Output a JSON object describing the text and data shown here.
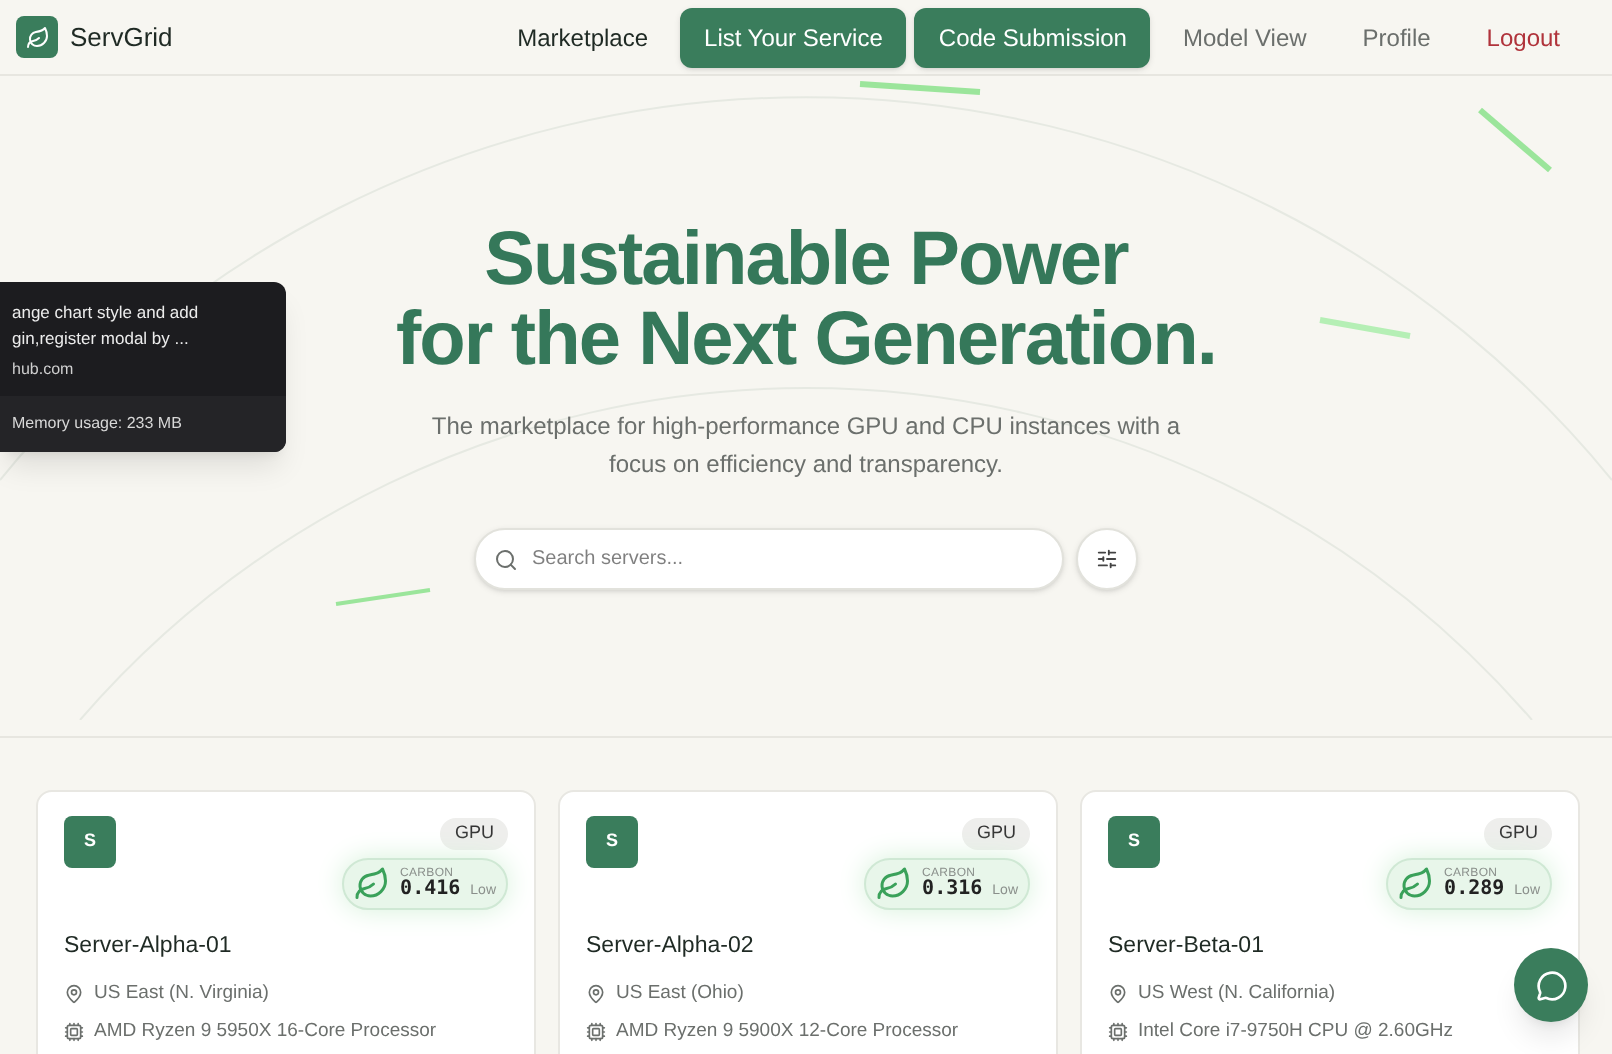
{
  "brand": {
    "name": "ServGrid"
  },
  "nav": [
    {
      "label": "Marketplace",
      "kind": "link"
    },
    {
      "label": "List Your Service",
      "kind": "primary"
    },
    {
      "label": "Code Submission",
      "kind": "primary"
    },
    {
      "label": "Model View",
      "kind": "muted"
    },
    {
      "label": "Profile",
      "kind": "muted"
    },
    {
      "label": "Logout",
      "kind": "danger"
    }
  ],
  "tooltip": {
    "lines": [
      "ange chart style and add",
      "gin,register modal by ..."
    ],
    "url": "hub.com",
    "memory": "Memory usage: 233 MB"
  },
  "hero": {
    "title_lines": [
      "Sustainable Power",
      "for the Next Generation."
    ],
    "subtitle": "The marketplace for high-performance GPU and CPU instances with a focus on efficiency and transparency."
  },
  "search": {
    "placeholder": "Search servers..."
  },
  "servers": [
    {
      "avatar": "S",
      "type": "GPU",
      "carbon_label": "CARBON",
      "carbon": "0.416",
      "carbon_rating": "Low",
      "name": "Server-Alpha-01",
      "location": "US East (N. Virginia)",
      "cpu": "AMD Ryzen 9 5950X 16-Core Processor"
    },
    {
      "avatar": "S",
      "type": "GPU",
      "carbon_label": "CARBON",
      "carbon": "0.316",
      "carbon_rating": "Low",
      "name": "Server-Alpha-02",
      "location": "US East (Ohio)",
      "cpu": "AMD Ryzen 9 5900X 12-Core Processor"
    },
    {
      "avatar": "S",
      "type": "GPU",
      "carbon_label": "CARBON",
      "carbon": "0.289",
      "carbon_rating": "Low",
      "name": "Server-Beta-01",
      "location": "US West (N. California)",
      "cpu": "Intel Core i7-9750H CPU @ 2.60GHz"
    }
  ]
}
